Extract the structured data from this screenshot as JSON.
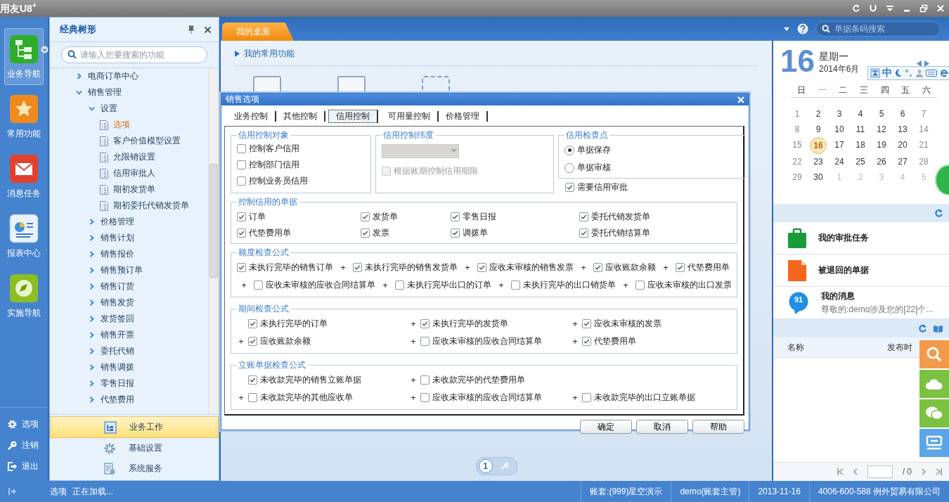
{
  "app": {
    "logo": "用友U8",
    "logo_sup": "+"
  },
  "nav": {
    "items": [
      {
        "label": "业务导航",
        "kind": "tree",
        "selected": true
      },
      {
        "label": "常用功能",
        "kind": "star",
        "selected": false
      },
      {
        "label": "消息任务",
        "kind": "mail",
        "selected": false
      },
      {
        "label": "报表中心",
        "kind": "report",
        "selected": false
      },
      {
        "label": "实施导航",
        "kind": "compass",
        "selected": false
      }
    ],
    "bottom": [
      {
        "label": "选项",
        "kind": "gear"
      },
      {
        "label": "注销",
        "kind": "key"
      },
      {
        "label": "退出",
        "kind": "exit"
      }
    ]
  },
  "tree_panel": {
    "title": "经典树形",
    "search": {
      "placeholder": "请输入您要搜索的功能"
    },
    "tree": [
      {
        "label": "电商订单中心",
        "expanded": false
      },
      {
        "label": "销售管理",
        "expanded": true,
        "children": [
          {
            "label": "设置",
            "expanded": true,
            "children": [
              {
                "label": "选项",
                "selected": true
              },
              {
                "label": "客户价值模型设置",
                "selected": false
              },
              {
                "label": "允限销设置",
                "selected": false
              },
              {
                "label": "信用审批人",
                "selected": false
              },
              {
                "label": "期初发货单",
                "selected": false
              },
              {
                "label": "期初委托代销发货单",
                "selected": false
              }
            ]
          },
          {
            "label": "价格管理",
            "expanded": false
          },
          {
            "label": "销售计划",
            "expanded": false
          },
          {
            "label": "销售报价",
            "expanded": false
          },
          {
            "label": "销售预订单",
            "expanded": false
          },
          {
            "label": "销售订货",
            "expanded": false
          },
          {
            "label": "销售发货",
            "expanded": false
          },
          {
            "label": "发货签回",
            "expanded": false
          },
          {
            "label": "销售开票",
            "expanded": false
          },
          {
            "label": "委托代销",
            "expanded": false
          },
          {
            "label": "销售调拨",
            "expanded": false
          },
          {
            "label": "零售日报",
            "expanded": false
          },
          {
            "label": "代垫费用",
            "expanded": false
          }
        ]
      }
    ],
    "modules": [
      {
        "label": "业务工作",
        "kind": "work",
        "selected": true
      },
      {
        "label": "基础设置",
        "kind": "gear",
        "selected": false
      },
      {
        "label": "系统服务",
        "kind": "server",
        "selected": false
      }
    ]
  },
  "tabs": [
    {
      "label": "我的桌面",
      "selected": true
    }
  ],
  "header_search": {
    "placeholder": "单据条码搜索"
  },
  "desktop": {
    "section_title": "我的常用功能",
    "pager": {
      "page": "1"
    }
  },
  "calendar": {
    "day": "16",
    "weekday": "星期一",
    "month": "2014年6月",
    "weekdays": [
      {
        "label": "日",
        "selected": false
      },
      {
        "label": "一",
        "selected": true
      },
      {
        "label": "二",
        "selected": false
      },
      {
        "label": "三",
        "selected": false
      },
      {
        "label": "四",
        "selected": false
      },
      {
        "label": "五",
        "selected": false
      },
      {
        "label": "六",
        "selected": false
      }
    ],
    "days": [
      {
        "label": "1",
        "muted": false,
        "selected": false
      },
      {
        "label": "2",
        "muted": false,
        "selected": false
      },
      {
        "label": "3",
        "muted": false,
        "selected": false
      },
      {
        "label": "4",
        "muted": false,
        "selected": false
      },
      {
        "label": "5",
        "muted": false,
        "selected": false
      },
      {
        "label": "6",
        "muted": false,
        "selected": false
      },
      {
        "label": "7",
        "muted": false,
        "selected": false
      },
      {
        "label": "8",
        "muted": false,
        "selected": false
      },
      {
        "label": "9",
        "muted": false,
        "selected": false
      },
      {
        "label": "10",
        "muted": false,
        "selected": false
      },
      {
        "label": "11",
        "muted": false,
        "selected": false
      },
      {
        "label": "12",
        "muted": false,
        "selected": false
      },
      {
        "label": "13",
        "muted": false,
        "selected": false
      },
      {
        "label": "14",
        "muted": false,
        "selected": false
      },
      {
        "label": "15",
        "muted": false,
        "selected": false
      },
      {
        "label": "16",
        "muted": false,
        "selected": true
      },
      {
        "label": "17",
        "muted": false,
        "selected": false
      },
      {
        "label": "18",
        "muted": false,
        "selected": false
      },
      {
        "label": "19",
        "muted": false,
        "selected": false
      },
      {
        "label": "20",
        "muted": false,
        "selected": false
      },
      {
        "label": "21",
        "muted": false,
        "selected": false
      },
      {
        "label": "22",
        "muted": false,
        "selected": false
      },
      {
        "label": "23",
        "muted": false,
        "selected": false
      },
      {
        "label": "24",
        "muted": false,
        "selected": false
      },
      {
        "label": "25",
        "muted": false,
        "selected": false
      },
      {
        "label": "26",
        "muted": false,
        "selected": false
      },
      {
        "label": "27",
        "muted": false,
        "selected": false
      },
      {
        "label": "28",
        "muted": false,
        "selected": false
      },
      {
        "label": "29",
        "muted": false,
        "selected": false
      },
      {
        "label": "30",
        "muted": false,
        "selected": false
      },
      {
        "label": "1",
        "muted": true,
        "selected": false
      },
      {
        "label": "2",
        "muted": true,
        "selected": false
      },
      {
        "label": "3",
        "muted": true,
        "selected": false
      },
      {
        "label": "4",
        "muted": true,
        "selected": false
      },
      {
        "label": "5",
        "muted": true,
        "selected": false
      }
    ]
  },
  "ime": {
    "mode": "中"
  },
  "tasks": [
    {
      "title": "我的审批任务",
      "kind": "approval"
    },
    {
      "title": "被退回的单据",
      "kind": "returned"
    },
    {
      "title": "我的消息",
      "kind": "message",
      "badge": "91",
      "subtitle": "尊敬的:demo涉及您的[22]个..."
    }
  ],
  "notices": {
    "columns": [
      "名称",
      "发布时"
    ],
    "pager": {
      "total": "/ 0"
    }
  },
  "dialog": {
    "title": "销售选项",
    "tabs": [
      {
        "label": "业务控制",
        "selected": false
      },
      {
        "label": "其他控制",
        "selected": false
      },
      {
        "label": "信用控制",
        "selected": true
      },
      {
        "label": "可用量控制",
        "selected": false
      },
      {
        "label": "价格管理",
        "selected": false
      }
    ],
    "credit_objects": {
      "legend": "信用控制对象",
      "items": [
        {
          "label": "控制客户信用",
          "checked": false
        },
        {
          "label": "控制部门信用",
          "checked": false
        },
        {
          "label": "控制业务员信用",
          "checked": false
        }
      ]
    },
    "credit_dimension": {
      "legend": "信用控制纬度",
      "select": {
        "disabled": true
      },
      "option": {
        "label": "根据账期控制信用期限",
        "checked": false,
        "disabled": true
      }
    },
    "check_point": {
      "legend": "信用检查点",
      "options": [
        {
          "label": "单据保存",
          "selected": true
        },
        {
          "label": "单据审核",
          "selected": false
        }
      ],
      "approval": {
        "label": "需要信用审批",
        "checked": true
      }
    },
    "documents": {
      "legend": "控制信用的单据",
      "items": [
        {
          "label": "订单",
          "checked": true
        },
        {
          "label": "发货单",
          "checked": true
        },
        {
          "label": "零售日报",
          "checked": true
        },
        {
          "label": "委托代销发货单",
          "checked": true
        },
        {
          "label": "代垫费用单",
          "checked": true
        },
        {
          "label": "发票",
          "checked": true
        },
        {
          "label": "调拨单",
          "checked": true
        },
        {
          "label": "委托代销结算单",
          "checked": true
        }
      ]
    },
    "formulas": [
      {
        "legend": "额度检查公式",
        "kind": "flow",
        "rows": [
          [
            {
              "label": "未执行完毕的销售订单",
              "checked": true
            },
            {
              "op": "+",
              "label": "未执行完毕的销售发货单",
              "checked": true
            },
            {
              "op": "+",
              "label": "应收未审核的销售发票",
              "checked": true
            },
            {
              "op": "+",
              "label": "应收账款余额",
              "checked": true
            },
            {
              "op": "+",
              "label": "代垫费用单",
              "checked": true
            }
          ],
          [
            {
              "op": "+",
              "label": "应收未审核的应收合同结算单",
              "checked": false
            },
            {
              "op": "+",
              "label": "未执行完毕出口的订单",
              "checked": false
            },
            {
              "op": "+",
              "label": "未执行完毕的出口销货单",
              "checked": false
            },
            {
              "op": "+",
              "label": "应收未审核的出口发票",
              "checked": false
            }
          ]
        ]
      },
      {
        "legend": "期间检查公式",
        "kind": "columns",
        "rows": [
          [
            {
              "label": "未执行完毕的订单",
              "checked": true
            },
            {
              "op": "+",
              "label": "未执行完毕的发货单",
              "checked": true
            },
            {
              "op": "+",
              "label": "应收未审核的发票",
              "checked": true
            }
          ],
          [
            {
              "op": "+",
              "label": "应收账款余额",
              "checked": true
            },
            {
              "op": "+",
              "label": "应收未审核的应收合同结算单",
              "checked": false
            },
            {
              "op": "+",
              "label": "代垫费用单",
              "checked": true
            }
          ]
        ]
      },
      {
        "legend": "立账单据检查公式",
        "kind": "columns",
        "rows": [
          [
            {
              "label": "未收款完毕的销售立账单据",
              "checked": true
            },
            {
              "op": "+",
              "label": "未收款完毕的代垫费用单",
              "checked": false
            }
          ],
          [
            {
              "op": "+",
              "label": "未收款完毕的其他应收单",
              "checked": false
            },
            {
              "op": "+",
              "label": "应收未审核的应收合同结算单",
              "checked": false
            },
            {
              "op": "+",
              "label": "未收款完毕的出口立账单据",
              "checked": false
            }
          ]
        ]
      }
    ],
    "buttons": [
      "确定",
      "取消",
      "帮助"
    ]
  },
  "status_bar": {
    "left": "选项",
    "message": "正在加载...",
    "segments": [
      "账套:(999)星空演示",
      "demo(账套主管)",
      "2013-11-16",
      "4006-600-588 例外贸易有限公司"
    ]
  }
}
